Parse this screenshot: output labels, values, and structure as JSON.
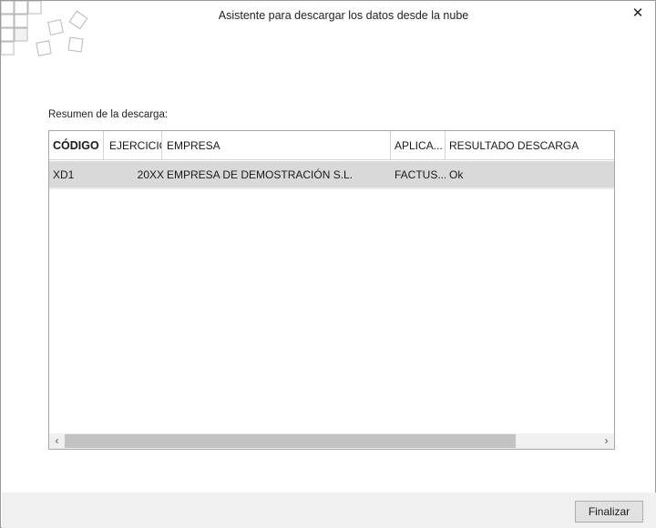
{
  "window": {
    "title": "Asistente para descargar los datos desde la nube",
    "close_glyph": "✕"
  },
  "summary": {
    "label": "Resumen de la descarga:"
  },
  "table": {
    "columns": [
      "CÓDIGO",
      "EJERCICIO",
      "EMPRESA",
      "APLICA...",
      "RESULTADO DESCARGA"
    ],
    "rows": [
      {
        "codigo": "XD1",
        "ejercicio": "20XX",
        "empresa": "EMPRESA DE DEMOSTRACIÓN S.L.",
        "aplicacion": "FACTUS...",
        "resultado": "Ok"
      }
    ],
    "scroll_left_glyph": "‹",
    "scroll_right_glyph": "›"
  },
  "footer": {
    "finish_label": "Finalizar"
  },
  "icons": {
    "logo": "logo-grid-squares-icon",
    "close": "close-icon",
    "scroll_left": "chevron-left-icon",
    "scroll_right": "chevron-right-icon"
  }
}
